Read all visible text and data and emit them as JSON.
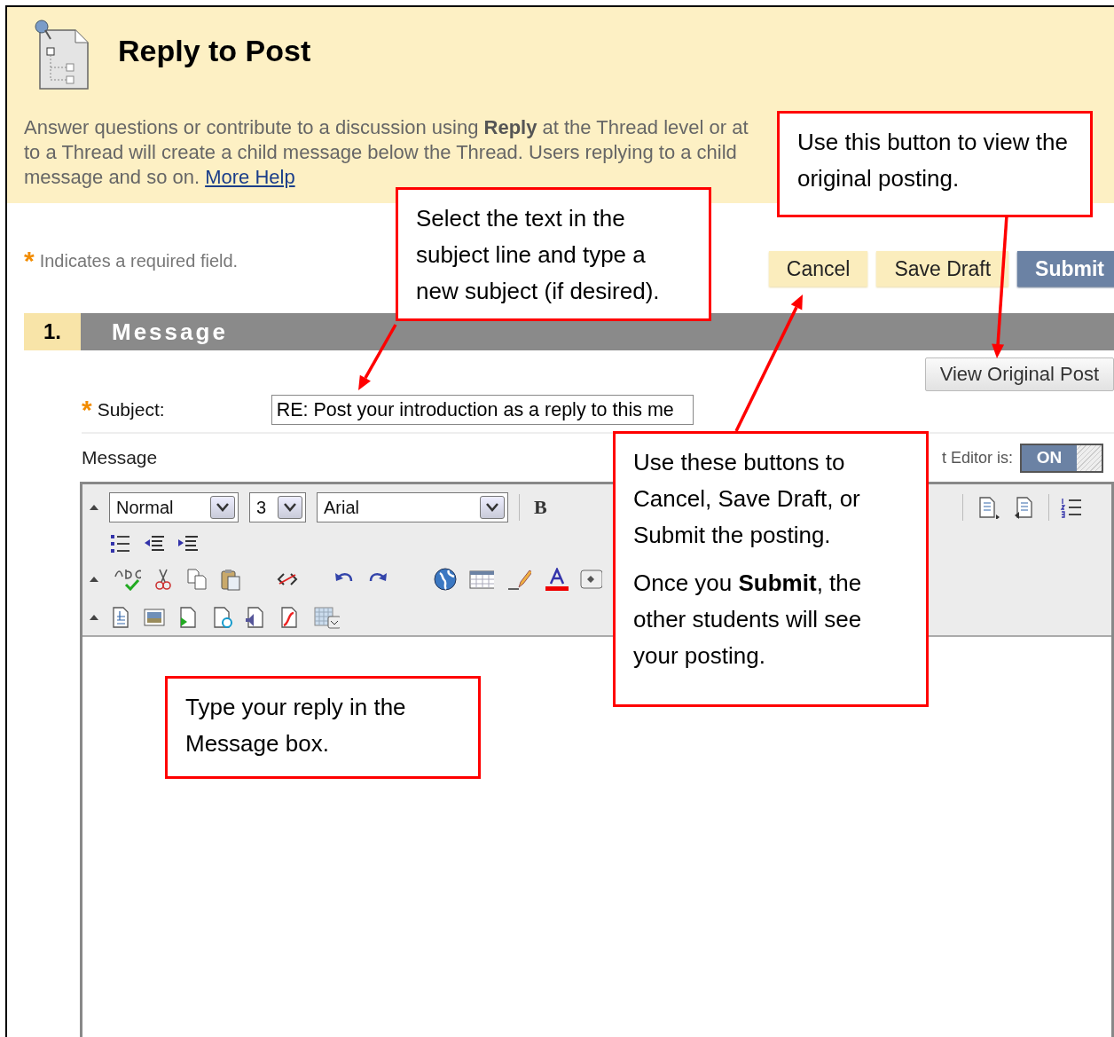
{
  "header": {
    "title": "Reply to Post",
    "description": [
      "Answer questions or contribute to a discussion using **Reply** at the Thread level or at",
      "to a Thread will create a child message below the Thread. Users replying to a child"
    ],
    "description_end": "message and so on.",
    "help_link": "More Help"
  },
  "required_note": {
    "mark": "*",
    "text": "Indicates a required field."
  },
  "actions": [
    {
      "label": "Cancel",
      "kind": "secondary"
    },
    {
      "label": "Save Draft",
      "kind": "secondary"
    },
    {
      "label": "Submit",
      "kind": "primary"
    }
  ],
  "section": {
    "number": "1.",
    "title": "Message"
  },
  "view_original_button": "View Original Post",
  "subject": {
    "mark": "*",
    "label": "Subject:",
    "value": "RE: Post your introduction as a reply to this me"
  },
  "message_label": "Message",
  "editor_toggle": {
    "label": "t Editor is:",
    "text": "ON",
    "on": true
  },
  "editor": {
    "paragraph_style": "Normal",
    "font_size": "3",
    "font_family": "Arial",
    "bold_button": "B"
  },
  "callouts": [
    {
      "paragraphs": [
        "Use this button to view the original posting."
      ]
    },
    {
      "paragraphs": [
        "Select the text in the subject line and type a new subject (if desired)."
      ]
    },
    {
      "paragraphs": [
        "Use these buttons to Cancel, Save Draft, or Submit the posting.",
        "Once you **Submit**, the other students will see your posting."
      ]
    },
    {
      "paragraphs": [
        "Type your reply in the Message box."
      ]
    }
  ]
}
